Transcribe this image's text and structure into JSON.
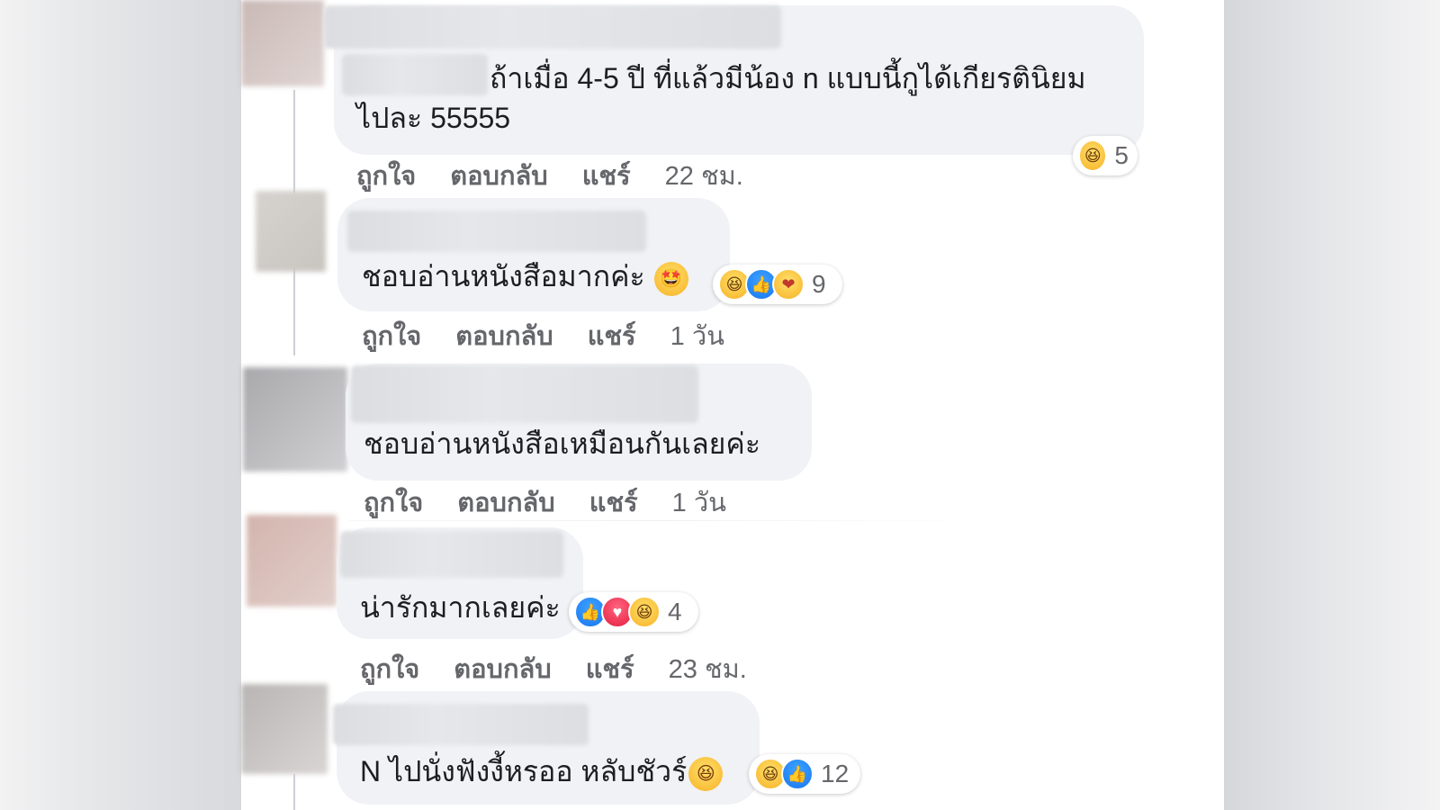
{
  "comments": [
    {
      "text_line1": "ถ้าเมื่อ 4-5 ปี ที่แล้วมีน้อง n แบบนี้กูได้เกียรตินิยม",
      "text_line2": "ไปละ 55555",
      "reactions": {
        "icons": [
          "haha-icon"
        ],
        "count": "5"
      },
      "actions": {
        "like": "ถูกใจ",
        "reply": "ตอบกลับ",
        "share": "แชร์",
        "time": "22 ชม."
      }
    },
    {
      "text": "ชอบอ่านหนังสือมากค่ะ",
      "inline_emoji": "star-struck-emoji",
      "reactions": {
        "icons": [
          "haha-icon",
          "like-icon",
          "care-icon"
        ],
        "count": "9"
      },
      "actions": {
        "like": "ถูกใจ",
        "reply": "ตอบกลับ",
        "share": "แชร์",
        "time": "1 วัน"
      }
    },
    {
      "text": "ชอบอ่านหนังสือเหมือนกันเลยค่ะ",
      "actions": {
        "like": "ถูกใจ",
        "reply": "ตอบกลับ",
        "share": "แชร์",
        "time": "1 วัน"
      }
    },
    {
      "text": "น่ารักมากเลยค่ะ",
      "reactions": {
        "icons": [
          "like-icon",
          "love-icon",
          "haha-icon"
        ],
        "count": "4"
      },
      "actions": {
        "like": "ถูกใจ",
        "reply": "ตอบกลับ",
        "share": "แชร์",
        "time": "23 ชม."
      }
    },
    {
      "text": "N ไปนั่งฟังงี้หรออ หลับชัวร์",
      "inline_emoji": "grinning-squinting-emoji",
      "reactions": {
        "icons": [
          "haha-icon",
          "like-icon"
        ],
        "count": "12"
      }
    }
  ],
  "colors": {
    "bubble": "#f0f2f5",
    "action_text": "#65676b",
    "comment_text": "#1c1e21",
    "like_blue": "#1877f2",
    "love_red": "#e41e3f",
    "haha_yellow": "#f7b125"
  }
}
